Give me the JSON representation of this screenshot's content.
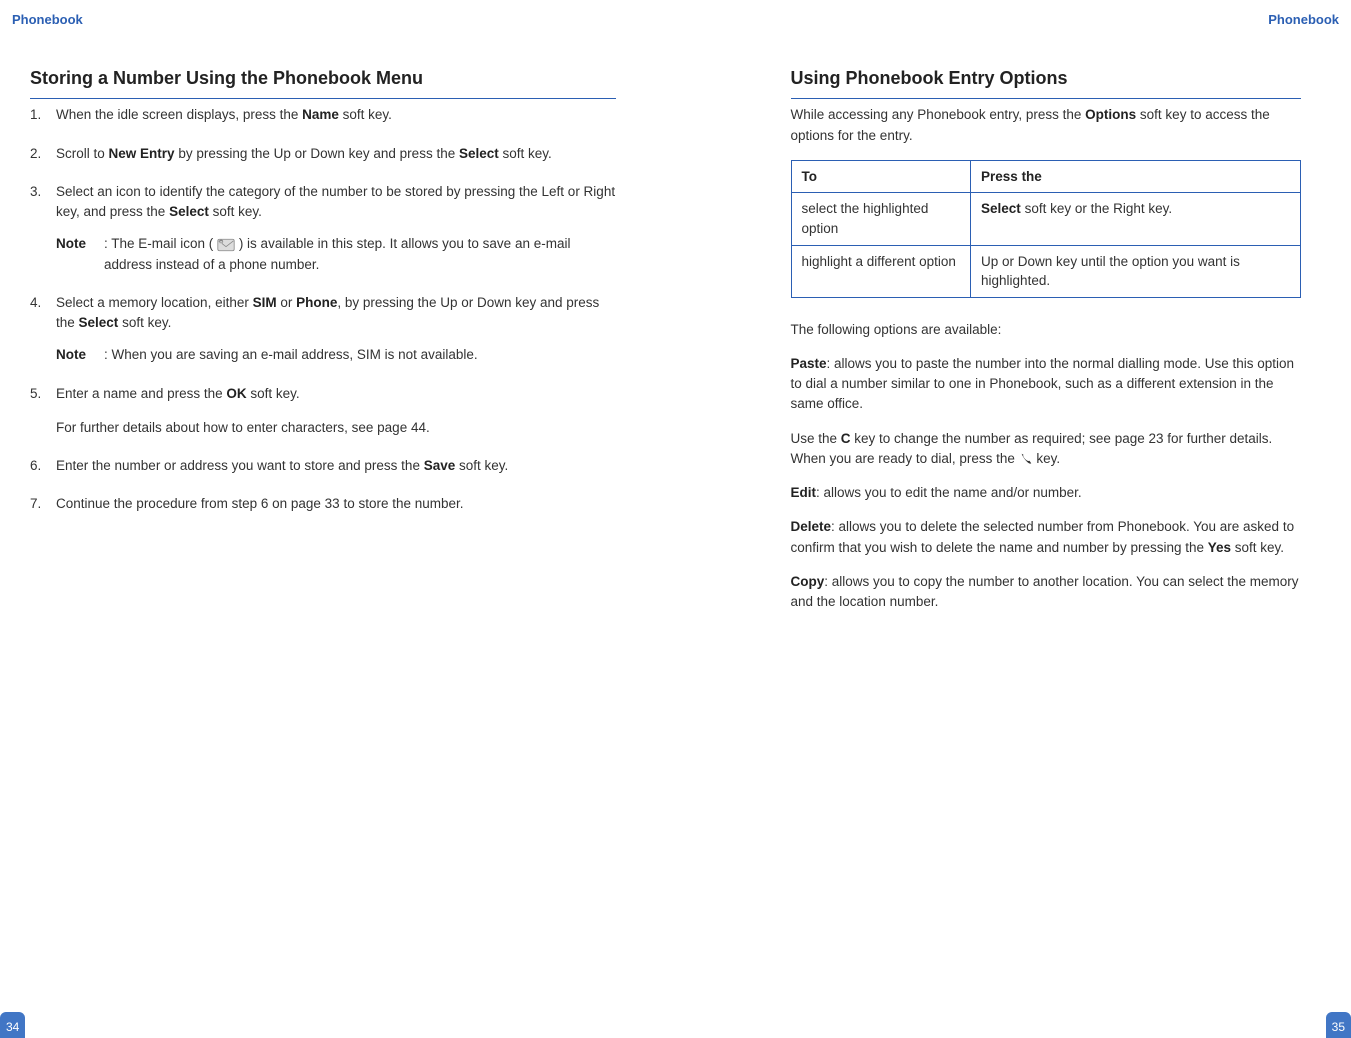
{
  "headerTitle": "Phonebook",
  "leftPage": {
    "pageNumber": "34",
    "sectionTitle": "Storing a Number Using the Phonebook Menu",
    "steps": {
      "s1_a": "When the idle screen displays, press the ",
      "s1_b": "Name",
      "s1_c": " soft key.",
      "s2_a": "Scroll to ",
      "s2_b": "New Entry",
      "s2_c": " by pressing the Up or Down key and press the ",
      "s2_d": "Select",
      "s2_e": " soft key.",
      "s3_a": "Select an icon to identify the category of the number to be stored by pressing the Left or Right key, and press the ",
      "s3_b": "Select",
      "s3_c": " soft key.",
      "s3_note_label": "Note",
      "s3_note_a": ": The E-mail icon ( ",
      "s3_note_b": " ) is available in this step. It allows you to save an e-mail address instead of a phone number.",
      "s4_a": "Select a memory location, either ",
      "s4_b": "SIM",
      "s4_c": " or ",
      "s4_d": "Phone",
      "s4_e": ", by pressing the Up or Down key and press the ",
      "s4_f": "Select",
      "s4_g": " soft key.",
      "s4_note_label": "Note",
      "s4_note_body": ": When you are saving an e-mail address, SIM is not available.",
      "s5_a": "Enter a name and press the ",
      "s5_b": "OK",
      "s5_c": " soft key.",
      "s5_sub": "For further details about how to enter characters, see page 44.",
      "s6_a": "Enter the number or address you want to store and press the ",
      "s6_b": "Save",
      "s6_c": " soft key.",
      "s7": "Continue the procedure from step 6 on page 33 to store the number."
    }
  },
  "rightPage": {
    "pageNumber": "35",
    "sectionTitle": "Using Phonebook Entry Options",
    "intro_a": "While accessing any Phonebook entry, press the ",
    "intro_b": "Options",
    "intro_c": " soft key to access the options for the entry.",
    "table": {
      "header": {
        "col1": "To",
        "col2": "Press the"
      },
      "row1": {
        "c1": "select the highlighted option",
        "c2_a": "Select",
        "c2_b": " soft key or the Right key."
      },
      "row2": {
        "c1": "highlight a different option",
        "c2": "Up or Down key until the option you want is highlighted."
      }
    },
    "followingLabel": "The following options are available:",
    "paste_label": "Paste",
    "paste_body": ": allows you to paste the number into the normal dialling mode. Use this option to dial a number similar to one in Phonebook, such as a different extension in the same office.",
    "useC_a": "Use the ",
    "useC_b": "C",
    "useC_c": " key to change the number as required; see page 23 for further details. When you are ready to dial, press the ",
    "useC_d": " key.",
    "edit_label": "Edit",
    "edit_body": ": allows you to edit the name and/or number.",
    "delete_label": "Delete",
    "delete_a": ": allows you to delete the selected number from Phonebook. You are asked to confirm that you wish to delete the name and number by pressing the ",
    "delete_b": "Yes",
    "delete_c": " soft key.",
    "copy_label": "Copy",
    "copy_body": ": allows you to copy the number to another location. You can select the memory and the location number."
  }
}
